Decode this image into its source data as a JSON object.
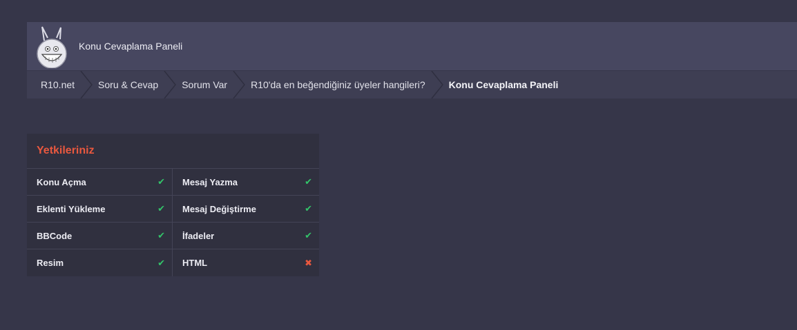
{
  "header": {
    "title": "Konu Cevaplama Paneli"
  },
  "breadcrumb": [
    {
      "label": "R10.net"
    },
    {
      "label": "Soru & Cevap"
    },
    {
      "label": "Sorum Var"
    },
    {
      "label": "R10'da en beğendiğiniz üyeler hangileri?"
    },
    {
      "label": "Konu Cevaplama Paneli"
    }
  ],
  "permissions": {
    "title": "Yetkileriniz",
    "items": [
      {
        "label": "Konu Açma",
        "allowed": true,
        "icon": "check-icon"
      },
      {
        "label": "Mesaj Yazma",
        "allowed": true,
        "icon": "check-icon"
      },
      {
        "label": "Eklenti Yükleme",
        "allowed": true,
        "icon": "check-icon"
      },
      {
        "label": "Mesaj Değiştirme",
        "allowed": true,
        "icon": "check-icon"
      },
      {
        "label": "BBCode",
        "allowed": true,
        "icon": "check-icon"
      },
      {
        "label": "İfadeler",
        "allowed": true,
        "icon": "check-icon"
      },
      {
        "label": "Resim",
        "allowed": true,
        "icon": "check-icon"
      },
      {
        "label": "HTML",
        "allowed": false,
        "icon": "cross-icon"
      }
    ]
  },
  "colors": {
    "background": "#363649",
    "header": "#474760",
    "accent": "#e9583f",
    "allowed": "#33c46a"
  }
}
